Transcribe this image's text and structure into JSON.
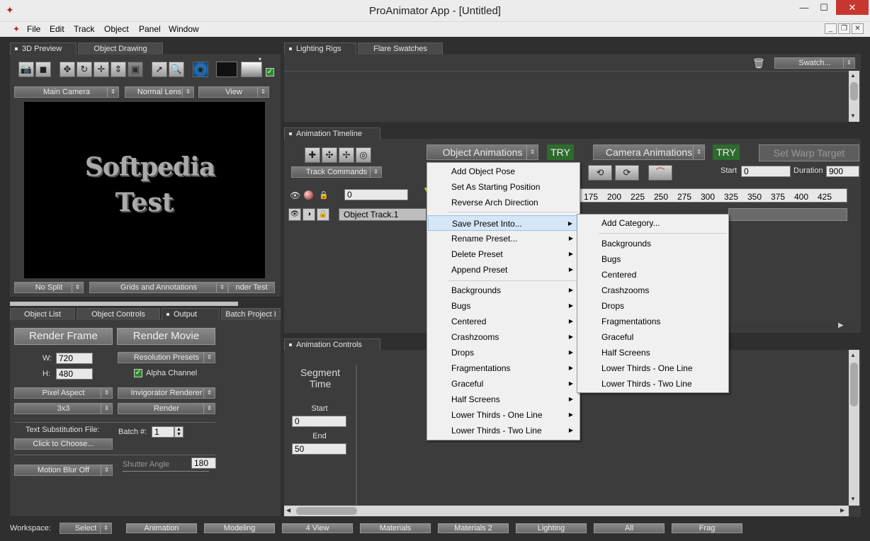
{
  "window": {
    "title": "ProAnimator App - [Untitled]",
    "min": "—",
    "max": "☐",
    "close": "✕"
  },
  "menu": [
    "File",
    "Edit",
    "Track",
    "Object",
    "Panel",
    "Window"
  ],
  "preview": {
    "tabs": [
      "3D Preview",
      "Object Drawing"
    ],
    "camera": "Main Camera",
    "lens": "Normal Lens",
    "view": "View",
    "text_line1": "Softpedia",
    "text_line2": "Test",
    "split": "No Split",
    "grids": "Grids and Annotations",
    "render_test": "nder Test"
  },
  "output": {
    "tabs": [
      "Object List",
      "Object Controls",
      "Output",
      "Batch Project I"
    ],
    "render_frame": "Render Frame",
    "render_movie": "Render Movie",
    "w_label": "W:",
    "w_value": "720",
    "h_label": "H:",
    "h_value": "480",
    "resolution_presets": "Resolution Presets",
    "alpha_channel": "Alpha Channel",
    "pixel_aspect": "Pixel Aspect",
    "renderer": "Invigorator Renderer",
    "aa": "3x3",
    "render": "Render",
    "text_sub_label": "Text Substitution File:",
    "click_choose": "Click to Choose...",
    "batch_label": "Batch #:",
    "batch_value": "1",
    "motion_blur": "Motion Blur Off",
    "shutter_label": "Shutter Angle",
    "shutter_value": "180"
  },
  "lighting": {
    "tabs": [
      "Lighting Rigs",
      "Flare Swatches"
    ],
    "swatch": "Swatch..."
  },
  "timeline": {
    "tab": "Animation Timeline",
    "object_anims": "Object Animations",
    "try1": "TRY",
    "camera_anims": "Camera Animations",
    "try2": "TRY",
    "set_warp": "Set Warp Target",
    "track_commands": "Track Commands",
    "start_label": "Start",
    "start_value": "0",
    "duration_label": "Duration",
    "duration_value": "900",
    "frame_value": "0",
    "ruler": [
      "175",
      "200",
      "225",
      "250",
      "275",
      "300",
      "325",
      "350",
      "375",
      "400",
      "425"
    ],
    "track_name": "Object Track.1"
  },
  "anim_controls": {
    "tab": "Animation Controls",
    "segment_time": [
      "Segment",
      "Time"
    ],
    "start_label": "Start",
    "start_value": "0",
    "end_label": "End",
    "end_value": "50"
  },
  "context_menu": {
    "items": [
      "Add Object Pose",
      "Set As Starting Position",
      "Reverse Arch Direction",
      "Save Preset Into...",
      "Rename Preset...",
      "Delete Preset",
      "Append Preset",
      "Backgrounds",
      "Bugs",
      "Centered",
      "Crashzooms",
      "Drops",
      "Fragmentations",
      "Graceful",
      "Half Screens",
      "Lower Thirds - One Line",
      "Lower Thirds - Two Line"
    ]
  },
  "submenu": {
    "items": [
      "Add Category...",
      "Backgrounds",
      "Bugs",
      "Centered",
      "Crashzooms",
      "Drops",
      "Fragmentations",
      "Graceful",
      "Half Screens",
      "Lower Thirds - One Line",
      "Lower Thirds - Two Line"
    ]
  },
  "workspace": {
    "label": "Workspace:",
    "select": "Select",
    "buttons": [
      "Animation",
      "Modeling",
      "4 View",
      "Materials",
      "Materials 2",
      "Lighting",
      "All",
      "Frag"
    ]
  },
  "colors": {
    "accent_green": "#2e6b2e",
    "menu_highlight": "#d5e6f7"
  }
}
